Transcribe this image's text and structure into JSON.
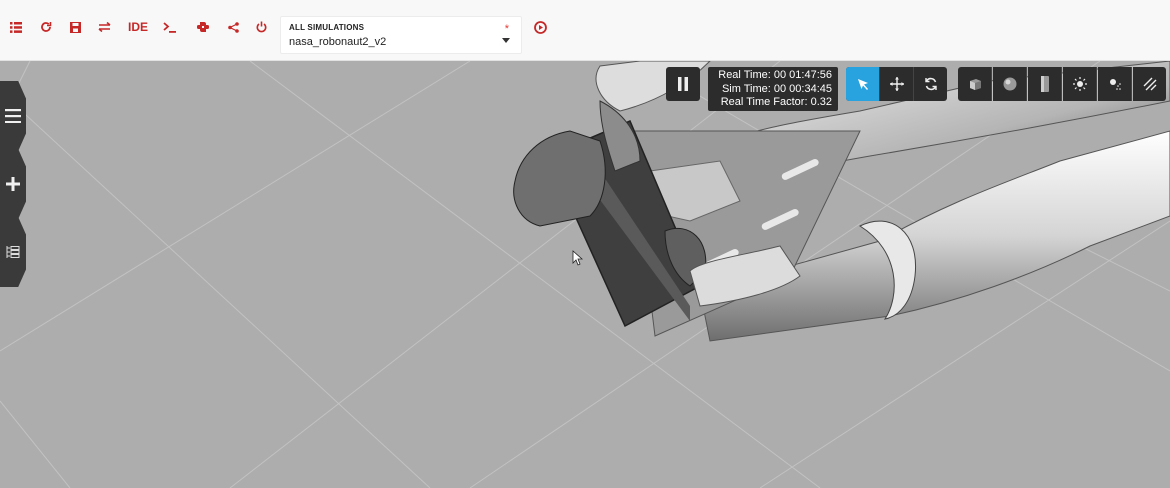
{
  "toolbar": {
    "buttons": [
      {
        "name": "menu-list-button",
        "icon": "list-icon",
        "glyph": "☰"
      },
      {
        "name": "reset-button",
        "icon": "refresh-icon",
        "glyph": "↻"
      },
      {
        "name": "save-button",
        "icon": "floppy-icon",
        "glyph": "▙"
      },
      {
        "name": "swap-button",
        "icon": "swap-arrows-icon",
        "glyph": "⇄"
      },
      {
        "name": "ide-button",
        "icon": "",
        "glyph": "IDE"
      },
      {
        "name": "terminal-button",
        "icon": "terminal-icon",
        "glyph": ">_"
      },
      {
        "name": "python-button",
        "icon": "python-icon",
        "glyph": "✚"
      },
      {
        "name": "share-button",
        "icon": "share-icon",
        "glyph": "<"
      },
      {
        "name": "power-button",
        "icon": "power-icon",
        "glyph": "⏻"
      }
    ],
    "simulation_select": {
      "label": "ALL SIMULATIONS",
      "value": "nasa_robonaut2_v2",
      "required_mark": "*"
    },
    "play_icon": "play-circle-icon",
    "accent_color": "#c62828"
  },
  "viewport": {
    "background": "#adadad",
    "side_tabs": [
      {
        "name": "menu-tab",
        "icon": "hamburger-icon"
      },
      {
        "name": "add-tab",
        "icon": "plus-icon"
      },
      {
        "name": "tree-tab",
        "icon": "tree-icon"
      }
    ],
    "pause_icon": "pause-icon",
    "real_time": "Real Time: 00 01:47:56",
    "sim_time": "Sim Time: 00 00:34:45",
    "rtf": "Real Time Factor: 0.32",
    "transform_tools": [
      {
        "name": "select-tool",
        "icon": "cursor-arrow-icon",
        "active": true
      },
      {
        "name": "translate-tool",
        "icon": "move-arrows-icon",
        "active": false
      },
      {
        "name": "rotate-tool",
        "icon": "rotate-icon",
        "active": false
      }
    ],
    "insert_tools": [
      {
        "name": "box-tool",
        "icon": "cube-icon"
      },
      {
        "name": "sphere-tool",
        "icon": "sphere-icon"
      },
      {
        "name": "cylinder-tool",
        "icon": "cylinder-icon"
      },
      {
        "name": "point-light-tool",
        "icon": "sun-icon"
      },
      {
        "name": "spot-light-tool",
        "icon": "spotlight-icon"
      },
      {
        "name": "directional-light-tool",
        "icon": "directional-light-icon"
      }
    ],
    "active_color": "#29a3df"
  }
}
